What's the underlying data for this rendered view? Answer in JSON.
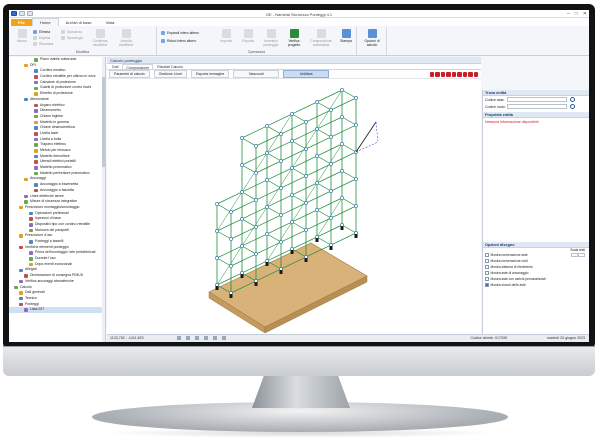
{
  "app": {
    "title": "GE - Namirial Sicurezza Ponteggi 4.1"
  },
  "tabs": [
    "File",
    "Home",
    "Archivi di base",
    "Vista"
  ],
  "ribbon": {
    "groups": [
      "Modifica",
      "Operazioni"
    ],
    "buttons": {
      "nuovo": "Nuovo",
      "elimina": "Elimina",
      "duplica": "Duplica",
      "rinomina": "Rinomina",
      "sposta_su": "Sposta su",
      "sposta_giu": "Sposta giù",
      "conferma": "Conferma modifiche",
      "annulla": "Annulla modifiche",
      "espandi": "Espandi intero albero",
      "riduci": "Riduci intero albero",
      "importa": "Importa",
      "esporta": "Esporta",
      "incentivo": "Incentivo ponteggio",
      "verifica": "Verifica progetto",
      "composizione": "Composizione automatica",
      "stampa": "Stampa",
      "opzioni": "Opzioni di calcolo"
    }
  },
  "tree": {
    "items": [
      "Piano viabile sottoruote",
      "DPI",
      "Cordino ematico",
      "Cordino retrattile per utilizzo in orizz",
      "Calzature di protezione",
      "Guanti di protezione contro rischi",
      "Elmetto di protezione",
      "Attrezzature",
      "Argano elettrico",
      "Dinamometro",
      "Chiave inglese",
      "Martello in gomma",
      "Chiave dinamometrica",
      "Livella laser",
      "Livella a bolla",
      "Trapano elettrico",
      "Metolo per intonaco",
      "Martello demolitore",
      "Utensili elettrici portatili",
      "Martello pneumatico",
      "Martello perforatore pneumatico",
      "Ancoraggi",
      "Ancoraggio a traversetta",
      "Ancoraggio a fascetta",
      "Linee elettriche aeree",
      "Misure di sicurezza integrative",
      "Prescrizioni montaggio/smontaggio",
      "Operazioni preliminari",
      "Ispezioni di base",
      "Dispositivi tipo con cordino retrattile",
      "Manovra dei parapetti",
      "Prescrizioni d'uso",
      "Ponteggi a tasselli",
      "Verifiche elementi ponteggio",
      "Prima dell'montaggio: tele prefabbricati",
      "Durante l'uso",
      "Dopo eventi eccezionali",
      "Allegati",
      "Dichiarazione di consegna PIMUS",
      "Verifica ancoraggi atmosferiche",
      "Calcolo",
      "Dati generali",
      "Tecnico",
      "Ponteggi",
      "Lista 027"
    ]
  },
  "panel": {
    "title": "Calcolo ponteggio",
    "tabs": [
      "Dati",
      "Composizione",
      "Risultati Calcolo"
    ],
    "toolbar": {
      "parametri": "Parametri di calcolo",
      "gestione": "Gestione Livori",
      "esporta": "Esporta immagine",
      "nascondi": "Nascondi",
      "unifilare": "Unifilare"
    }
  },
  "right": {
    "trova_title": "Trova entità",
    "codice_asta": "Codice asta:",
    "codice_nodo": "Codice nodo:",
    "proprieta_title": "Proprietà entità",
    "no_info": "Nessuna informazione disponibile",
    "opzioni_title": "Opzioni disegno",
    "options": [
      {
        "label": "Mostra numerazione aste",
        "checked": false,
        "value": "1"
      },
      {
        "label": "Mostra numerazione nodi",
        "checked": false,
        "value": ""
      },
      {
        "label": "Mostra sistema di riferimento",
        "checked": false,
        "value": ""
      },
      {
        "label": "Mostra aste di ancoraggio",
        "checked": false,
        "value": ""
      },
      {
        "label": "Mostra aste con carichi personalizzati",
        "checked": false,
        "value": ""
      },
      {
        "label": "Mostra vincoli delle aste",
        "checked": true,
        "value": ""
      }
    ],
    "scala_label": "Scala testi"
  },
  "status": {
    "coords": "1133,782 ; -1411,823",
    "client": "Codice cliente: 017335",
    "date": "martedì 20 giugno 2023"
  },
  "colors": {
    "accent": "#2a6fd1",
    "file_tab": "#f3a31a",
    "scaffold": "#1e8f3a",
    "node": "#1b5fa8",
    "base_plank": "#d9b27a",
    "warning_red": "#c8202a"
  }
}
